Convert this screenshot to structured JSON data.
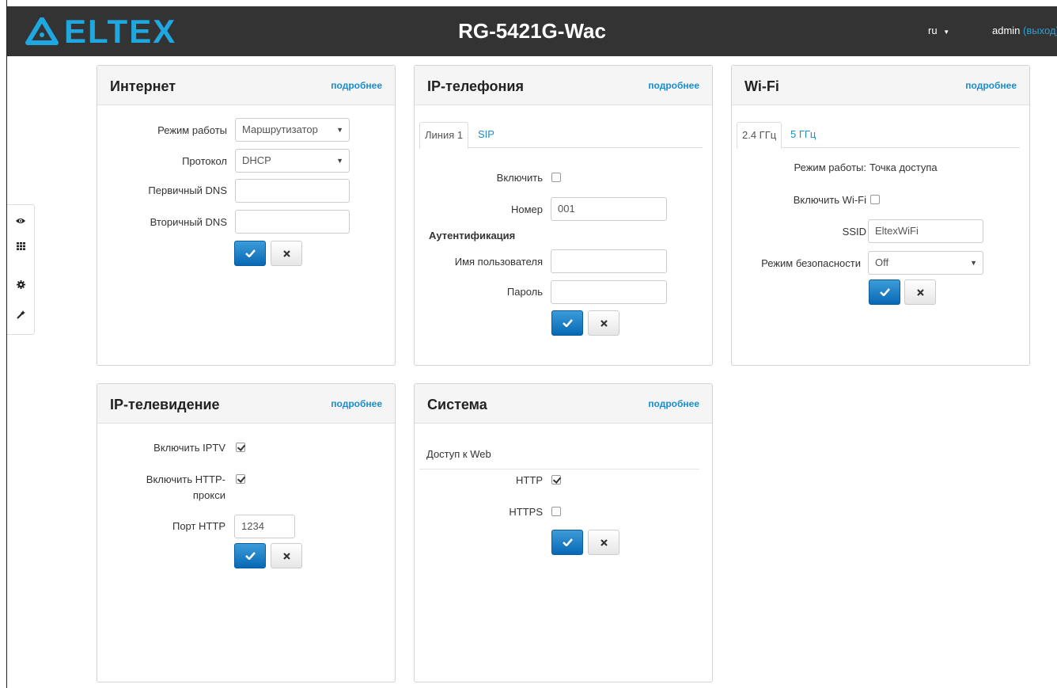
{
  "header": {
    "brand": "ELTEX",
    "device_title": "RG-5421G-Wac",
    "language": "ru",
    "user": "admin",
    "logout": "(выход)"
  },
  "sidebar": {
    "items": [
      {
        "icon": "eye-icon"
      },
      {
        "icon": "grid-icon"
      },
      {
        "icon": "gear-icon"
      },
      {
        "icon": "wand-icon"
      }
    ]
  },
  "common": {
    "more_link": "подробнее"
  },
  "internet": {
    "title": "Интернет",
    "mode_label": "Режим работы",
    "mode_value": "Маршрутизатор",
    "protocol_label": "Протокол",
    "protocol_value": "DHCP",
    "dns1_label": "Первичный DNS",
    "dns1_value": "",
    "dns2_label": "Вторичный DNS",
    "dns2_value": ""
  },
  "voip": {
    "title": "IP-телефония",
    "tab_line": "Линия 1",
    "tab_sip": "SIP",
    "enable_label": "Включить",
    "enable_checked": false,
    "number_label": "Номер",
    "number_value": "001",
    "auth_title": "Аутентификация",
    "username_label": "Имя пользователя",
    "username_value": "",
    "password_label": "Пароль",
    "password_value": ""
  },
  "wifi": {
    "title": "Wi-Fi",
    "tab_24": "2.4 ГГц",
    "tab_5": "5 ГГц",
    "mode_label": "Режим работы:",
    "mode_value": "Точка доступа",
    "enable_label": "Включить Wi-Fi",
    "enable_checked": false,
    "ssid_label": "SSID",
    "ssid_value": "EltexWiFi",
    "security_label": "Режим безопасности",
    "security_value": "Off"
  },
  "iptv": {
    "title": "IP-телевидение",
    "enable_label": "Включить IPTV",
    "enable_checked": true,
    "proxy_label_1": "Включить HTTP-",
    "proxy_label_2": "прокси",
    "proxy_checked": true,
    "port_label": "Порт HTTP",
    "port_value": "1234"
  },
  "system": {
    "title": "Система",
    "web_access_title": "Доступ к Web",
    "http_label": "HTTP",
    "http_checked": true,
    "https_label": "HTTPS",
    "https_checked": false
  },
  "colors": {
    "navbar": "#333333",
    "brand": "#1fa7e0",
    "link": "#1a8dd0",
    "primary_button": "#0868b5"
  }
}
